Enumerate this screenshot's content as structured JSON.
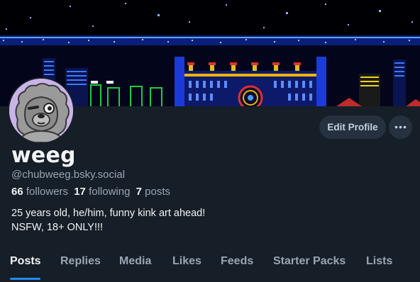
{
  "profile": {
    "display_name": "weeg",
    "handle": "@chubweeg.bsky.social",
    "stats": {
      "followers_count": "66",
      "followers_label": "followers",
      "following_count": "17",
      "following_label": "following",
      "posts_count": "7",
      "posts_label": "posts"
    },
    "bio_lines": [
      "25 years old, he/him, funny kink art ahead!",
      "NSFW, 18+ ONLY!!!"
    ]
  },
  "actions": {
    "edit_profile_label": "Edit Profile",
    "more_icon": "ellipsis-icon"
  },
  "tabs": [
    {
      "label": "Posts",
      "active": true
    },
    {
      "label": "Replies",
      "active": false
    },
    {
      "label": "Media",
      "active": false
    },
    {
      "label": "Likes",
      "active": false
    },
    {
      "label": "Feeds",
      "active": false
    },
    {
      "label": "Starter Packs",
      "active": false
    },
    {
      "label": "Lists",
      "active": false
    }
  ],
  "colors": {
    "background": "#161e27",
    "accent": "#1f8bf2",
    "button_bg": "#263140",
    "muted_text": "#9aa5b2",
    "primary_text": "#f1f3f5"
  }
}
